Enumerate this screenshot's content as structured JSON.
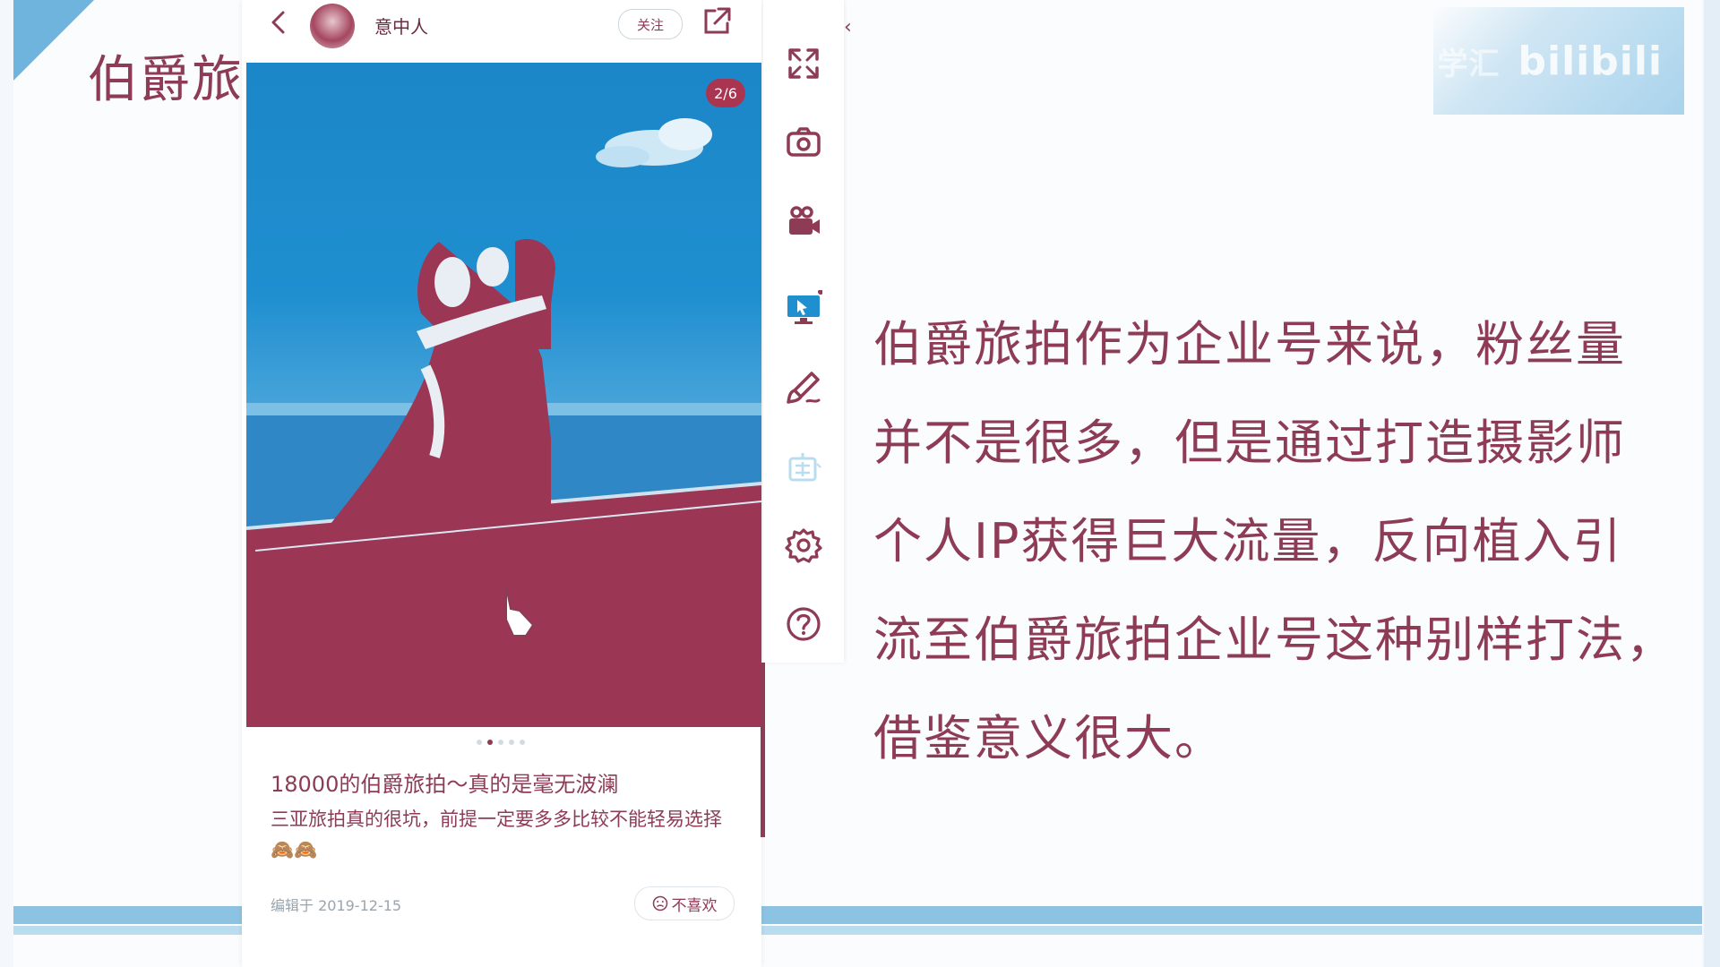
{
  "slide": {
    "title": "伯爵旅拍",
    "body_lines": [
      "伯爵旅拍作为企业号来说，粉丝量",
      "并不是很多，但是通过打造摄影师",
      "个人IP获得巨大流量，反向植入引",
      "流至伯爵旅拍企业号这种别样打法，",
      "借鉴意义很大。"
    ],
    "watermark_prefix": "学汇",
    "watermark": "bilibili"
  },
  "phone": {
    "username": "意中人",
    "follow_label": "关注",
    "page_indicator": "2/6",
    "post_title": "18000的伯爵旅拍～真的是毫无波澜",
    "post_desc": "三亚旅拍真的很坑，前提一定要多多比较不能轻易选择🙈🙈",
    "post_date": "编辑于 2019-12-15",
    "dislike_label": "不喜欢"
  },
  "toolbar": {
    "collapse_glyph": "‹",
    "tools": [
      "fullscreen-icon",
      "camera-icon",
      "video-camera-icon",
      "screen-share-icon",
      "brush-icon",
      "translate-icon",
      "settings-icon",
      "help-icon"
    ]
  },
  "colors": {
    "accent": "#8e3b55",
    "blue": "#1f8fd0"
  }
}
